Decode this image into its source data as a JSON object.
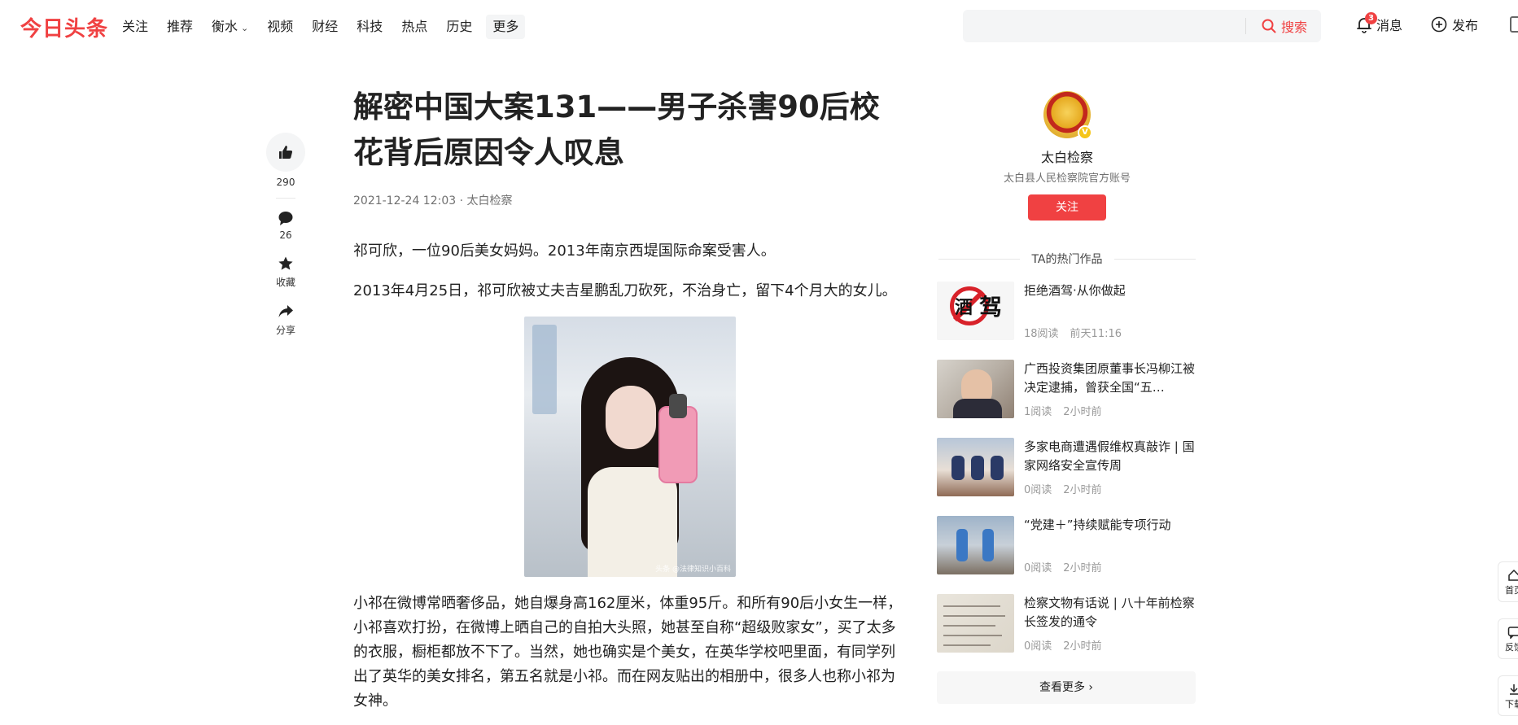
{
  "header": {
    "logo": "今日头条",
    "nav": [
      "关注",
      "推荐",
      "衡水",
      "视频",
      "财经",
      "科技",
      "热点",
      "历史"
    ],
    "more": "更多",
    "search_button": "搜索",
    "search_placeholder": "",
    "messages_label": "消息",
    "messages_badge": "3",
    "publish_label": "发布"
  },
  "rail": {
    "likes": "290",
    "comments": "26",
    "favorite_label": "收藏",
    "share_label": "分享"
  },
  "article": {
    "title": "解密中国大案131——男子杀害90后校花背后原因令人叹息",
    "meta": "2021-12-24 12:03 · 太白检察",
    "p1": "祁可欣，一位90后美女妈妈。2013年南京西堤国际命案受害人。",
    "p2": "2013年4月25日，祁可欣被丈夫吉星鹏乱刀砍死，不治身亡，留下4个月大的女儿。",
    "image_watermark": "头条 @法律知识小百科",
    "p3": "小祁在微博常晒奢侈品，她自爆身高162厘米，体重95斤。和所有90后小女生一样，小祁喜欢打扮，在微博上晒自己的自拍大头照，她甚至自称“超级败家女”，买了太多的衣服，橱柜都放不下了。当然，她也确实是个美女，在英华学校吧里面，有同学列出了英华的美女排名，第五名就是小祁。而在网友贴出的相册中，很多人也称小祁为女神。"
  },
  "author": {
    "name": "太白检察",
    "desc": "太白县人民检察院官方账号",
    "follow": "关注",
    "verified_mark": "V"
  },
  "hot": {
    "heading": "TA的热门作品",
    "items": [
      {
        "title": "拒绝酒驾·从你做起",
        "reads": "18阅读",
        "time": "前天11:16",
        "thumb_glyphs": [
          "酒",
          "驾"
        ]
      },
      {
        "title": "广西投资集团原董事长冯柳江被决定逮捕，曾获全国“五…",
        "reads": "1阅读",
        "time": "2小时前"
      },
      {
        "title": "多家电商遭遇假维权真敲诈 | 国家网络安全宣传周",
        "reads": "0阅读",
        "time": "2小时前"
      },
      {
        "title": "“党建＋”持续赋能专项行动",
        "reads": "0阅读",
        "time": "2小时前"
      },
      {
        "title": "检察文物有话说 | 八十年前检察长签发的通令",
        "reads": "0阅读",
        "time": "2小时前"
      }
    ],
    "see_more": "查看更多 ›"
  },
  "floating": {
    "home": "首页",
    "feedback": "反馈",
    "download": "下载"
  },
  "colors": {
    "brand": "#f04142",
    "text": "#222222",
    "muted": "#999999"
  }
}
